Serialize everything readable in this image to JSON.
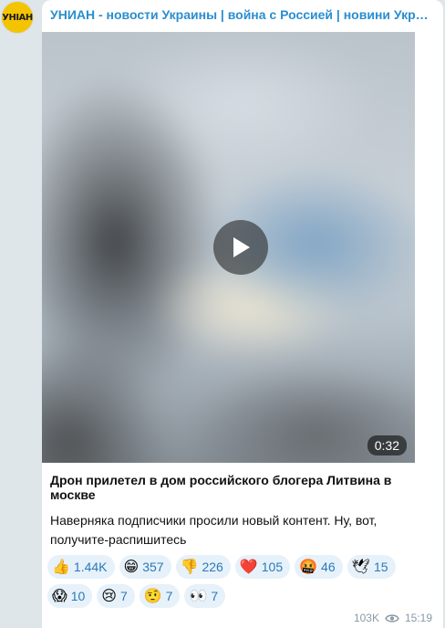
{
  "channel": {
    "avatar_text": "УНІАН",
    "name": "УНИАН - новости Украины | война с Россией | новини Україні…"
  },
  "video": {
    "duration": "0:32"
  },
  "post": {
    "headline": "Дрон прилетел в дом российского блогера Литвина в москве",
    "body": "Наверняка подписчики просили новый контент. Ну, вот, получите-распишитесь"
  },
  "reactions": [
    {
      "emoji": "👍",
      "count": "1.44K"
    },
    {
      "emoji": "😁",
      "count": "357"
    },
    {
      "emoji": "👎",
      "count": "226"
    },
    {
      "emoji": "❤️",
      "count": "105"
    },
    {
      "emoji": "🤬",
      "count": "46"
    },
    {
      "emoji": "🕊",
      "count": "15"
    },
    {
      "emoji": "😱",
      "count": "10"
    },
    {
      "emoji": "😢",
      "count": "7"
    },
    {
      "emoji": "🤨",
      "count": "7"
    },
    {
      "emoji": "👀",
      "count": "7"
    }
  ],
  "meta": {
    "views": "103K",
    "time": "15:19"
  }
}
